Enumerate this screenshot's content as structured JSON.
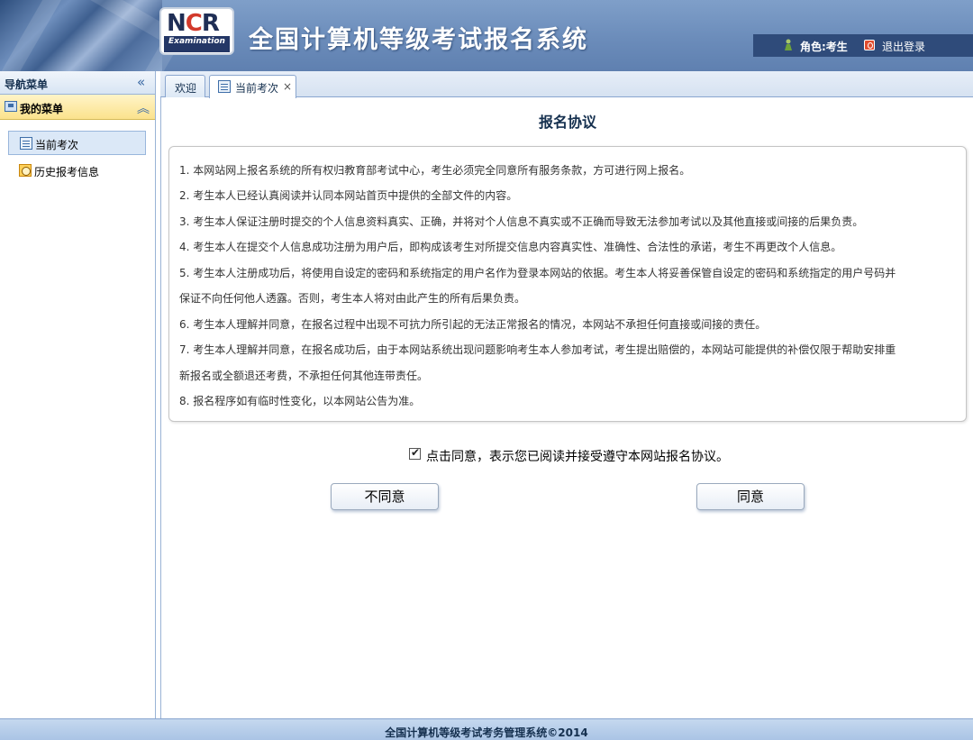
{
  "header": {
    "logo_text_n": "N",
    "logo_text_c": "C",
    "logo_text_r": "R",
    "logo_exam": "Examination",
    "title": "全国计算机等级考试报名系统",
    "role": "角色:考生",
    "logout": "退出登录"
  },
  "sidebar": {
    "title": "导航菜单",
    "collapse_icon": "double-chevron-left-icon",
    "group": "我的菜单",
    "items": [
      {
        "label": "当前考次",
        "icon": "document-icon"
      },
      {
        "label": "历史报考信息",
        "icon": "clock-icon"
      }
    ]
  },
  "tabs": [
    {
      "label": "欢迎"
    },
    {
      "label": "当前考次",
      "close": "×"
    }
  ],
  "agreement": {
    "title": "报名协议",
    "lines": [
      "1. 本网站网上报名系统的所有权归教育部考试中心，考生必须完全同意所有服务条款，方可进行网上报名。",
      "2. 考生本人已经认真阅读并认同本网站首页中提供的全部文件的内容。",
      "3. 考生本人保证注册时提交的个人信息资料真实、正确，并将对个人信息不真实或不正确而导致无法参加考试以及其他直接或间接的后果负责。",
      "4. 考生本人在提交个人信息成功注册为用户后，即构成该考生对所提交信息内容真实性、准确性、合法性的承诺，考生不再更改个人信息。",
      "5. 考生本人注册成功后，将使用自设定的密码和系统指定的用户名作为登录本网站的依据。考生本人将妥善保管自设定的密码和系统指定的用户号码并",
      "保证不向任何他人透露。否则，考生本人将对由此产生的所有后果负责。",
      "6. 考生本人理解并同意，在报名过程中出现不可抗力所引起的无法正常报名的情况，本网站不承担任何直接或间接的责任。",
      "7. 考生本人理解并同意，在报名成功后，由于本网站系统出现问题影响考生本人参加考试，考生提出赔偿的，本网站可能提供的补偿仅限于帮助安排重",
      "新报名或全额退还考费，不承担任何其他连带责任。",
      "8. 报名程序如有临时性变化，以本网站公告为准。"
    ],
    "checkbox_checked": true,
    "checkbox_mark": "✔",
    "checkbox_label": "点击同意，表示您已阅读并接受遵守本网站报名协议。",
    "disagree_button": "不同意",
    "agree_button": "同意"
  },
  "footer": {
    "text": "全国计算机等级考试考务管理系统©2014"
  }
}
